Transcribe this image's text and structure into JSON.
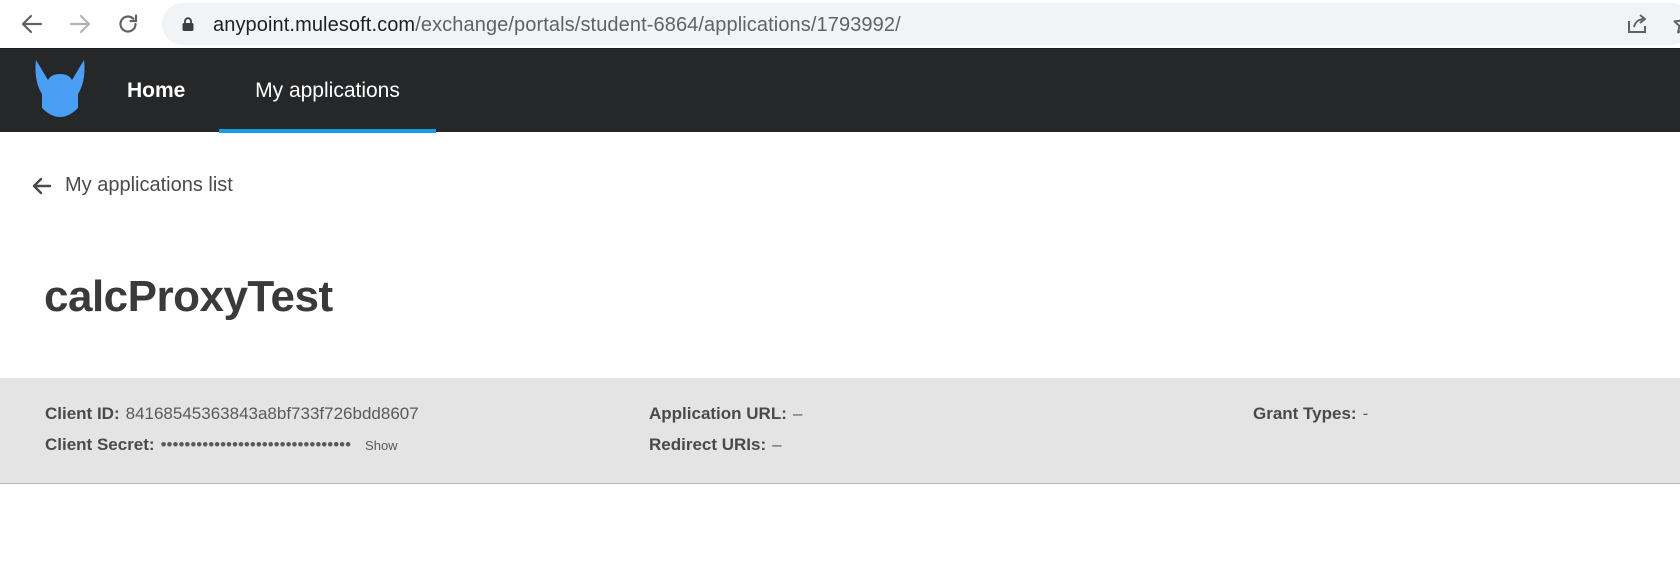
{
  "browser": {
    "url_host": "anypoint.mulesoft.com",
    "url_path": "/exchange/portals/student-6864/applications/1793992/"
  },
  "header": {
    "tabs": [
      {
        "label": "Home",
        "active": false
      },
      {
        "label": "My applications",
        "active": true
      }
    ],
    "accent_color": "#1a9be6",
    "background_color": "#262728",
    "logo_icon": "horned-shield-logo"
  },
  "back_link": {
    "label": "My applications list"
  },
  "app": {
    "title": "calcProxyTest",
    "client_id_label": "Client ID:",
    "client_id": "84168545363843a8bf733f726bdd8607",
    "client_secret_label": "Client Secret:",
    "client_secret_masked": "••••••••••••••••••••••••••••••••",
    "show_label": "Show",
    "application_url_label": "Application URL:",
    "application_url": "–",
    "redirect_uris_label": "Redirect URIs:",
    "redirect_uris": "–",
    "grant_types_label": "Grant Types:",
    "grant_types": "-"
  }
}
